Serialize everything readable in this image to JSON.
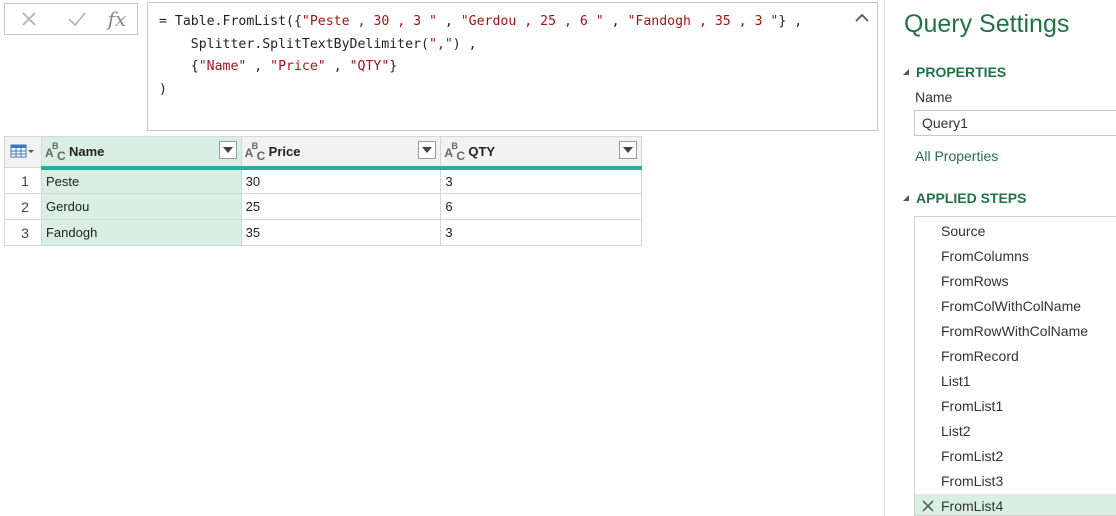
{
  "formula_bar": {
    "fx_label": "fx",
    "formula_lines": [
      {
        "parts": [
          {
            "t": "= Table.FromList({",
            "s": false
          },
          {
            "t": "\"Peste , 30 , 3 \"",
            "s": true
          },
          {
            "t": " , ",
            "s": false
          },
          {
            "t": "\"Gerdou , 25 , 6 \"",
            "s": true
          },
          {
            "t": " , ",
            "s": false
          },
          {
            "t": "\"Fandogh , 35 , 3 \"",
            "s": true
          },
          {
            "t": "} ,",
            "s": false
          }
        ]
      },
      {
        "parts": [
          {
            "t": "    Splitter.SplitTextByDelimiter(",
            "s": false
          },
          {
            "t": "\",\"",
            "s": true
          },
          {
            "t": ") ,",
            "s": false
          }
        ]
      },
      {
        "parts": [
          {
            "t": "    {",
            "s": false
          },
          {
            "t": "\"Name\"",
            "s": true
          },
          {
            "t": " , ",
            "s": false
          },
          {
            "t": "\"Price\"",
            "s": true
          },
          {
            "t": " , ",
            "s": false
          },
          {
            "t": "\"QTY\"",
            "s": true
          },
          {
            "t": "}",
            "s": false
          }
        ]
      },
      {
        "parts": [
          {
            "t": ")",
            "s": false
          }
        ]
      }
    ]
  },
  "grid": {
    "columns": [
      "Name",
      "Price",
      "QTY"
    ],
    "rows": [
      {
        "index": "1",
        "cells": [
          "Peste",
          "30",
          "3"
        ]
      },
      {
        "index": "2",
        "cells": [
          "Gerdou",
          "25",
          "6"
        ]
      },
      {
        "index": "3",
        "cells": [
          "Fandogh",
          "35",
          "3"
        ]
      }
    ],
    "type_icon": "abc-text-icon"
  },
  "settings": {
    "title": "Query Settings",
    "properties_header": "PROPERTIES",
    "name_label": "Name",
    "name_value": "Query1",
    "all_properties": "All Properties",
    "applied_steps_header": "APPLIED STEPS",
    "steps": [
      "Source",
      "FromColumns",
      "FromRows",
      "FromColWithColName",
      "FromRowWithColName",
      "FromRecord",
      "List1",
      "FromList1",
      "List2",
      "FromList2",
      "FromList3",
      "FromList4"
    ],
    "active_step": "FromList4"
  },
  "colors": {
    "accent": "#217346",
    "selected_fill": "#d9efe4",
    "header_rule": "#20b2a0",
    "string_literal": "#a31515"
  }
}
